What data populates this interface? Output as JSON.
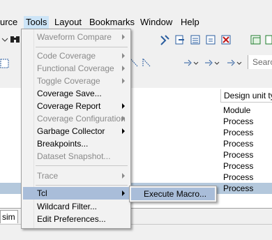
{
  "menubar": {
    "items": [
      {
        "label": "urce"
      },
      {
        "label": "Tools"
      },
      {
        "label": "Layout"
      },
      {
        "label": "Bookmarks"
      },
      {
        "label": "Window"
      },
      {
        "label": "Help"
      }
    ]
  },
  "toolbar": {
    "search_placeholder": "Searc"
  },
  "list": {
    "column_header": "Design unit typ",
    "rows": [
      {
        "value": "Module"
      },
      {
        "value": "Process"
      },
      {
        "value": "Process"
      },
      {
        "value": "Process"
      },
      {
        "value": "Process"
      },
      {
        "value": "Process"
      },
      {
        "value": "Process"
      },
      {
        "value": "Process"
      }
    ]
  },
  "tabs": {
    "active": "sim"
  },
  "tools_menu": {
    "items": [
      {
        "label": "Waveform Compare",
        "disabled": true,
        "submenu": true
      },
      {
        "label": "Code Coverage",
        "disabled": true,
        "submenu": true
      },
      {
        "label": "Functional Coverage",
        "disabled": true,
        "submenu": true
      },
      {
        "label": "Toggle Coverage",
        "disabled": true,
        "submenu": true
      },
      {
        "label": "Coverage Save...",
        "disabled": false,
        "submenu": false
      },
      {
        "label": "Coverage Report",
        "disabled": false,
        "submenu": true
      },
      {
        "label": "Coverage Configuration",
        "disabled": true,
        "submenu": true
      },
      {
        "label": "Garbage Collector",
        "disabled": false,
        "submenu": true
      },
      {
        "label": "Breakpoints...",
        "disabled": false,
        "submenu": false
      },
      {
        "label": "Dataset Snapshot...",
        "disabled": true,
        "submenu": false
      },
      {
        "label": "Trace",
        "disabled": true,
        "submenu": true
      },
      {
        "label": "Tcl",
        "disabled": false,
        "submenu": true,
        "highlighted": true
      },
      {
        "label": "Wildcard Filter...",
        "disabled": false,
        "submenu": false
      },
      {
        "label": "Edit Preferences...",
        "disabled": false,
        "submenu": false
      }
    ]
  },
  "tcl_submenu": {
    "items": [
      {
        "label": "Execute Macro..."
      }
    ]
  },
  "colors": {
    "menu_highlight": "#a9bdd9",
    "selected_row": "#b4c8dc",
    "disabled_text": "#8a8a8a",
    "menubar_active": "#cce4f7"
  }
}
